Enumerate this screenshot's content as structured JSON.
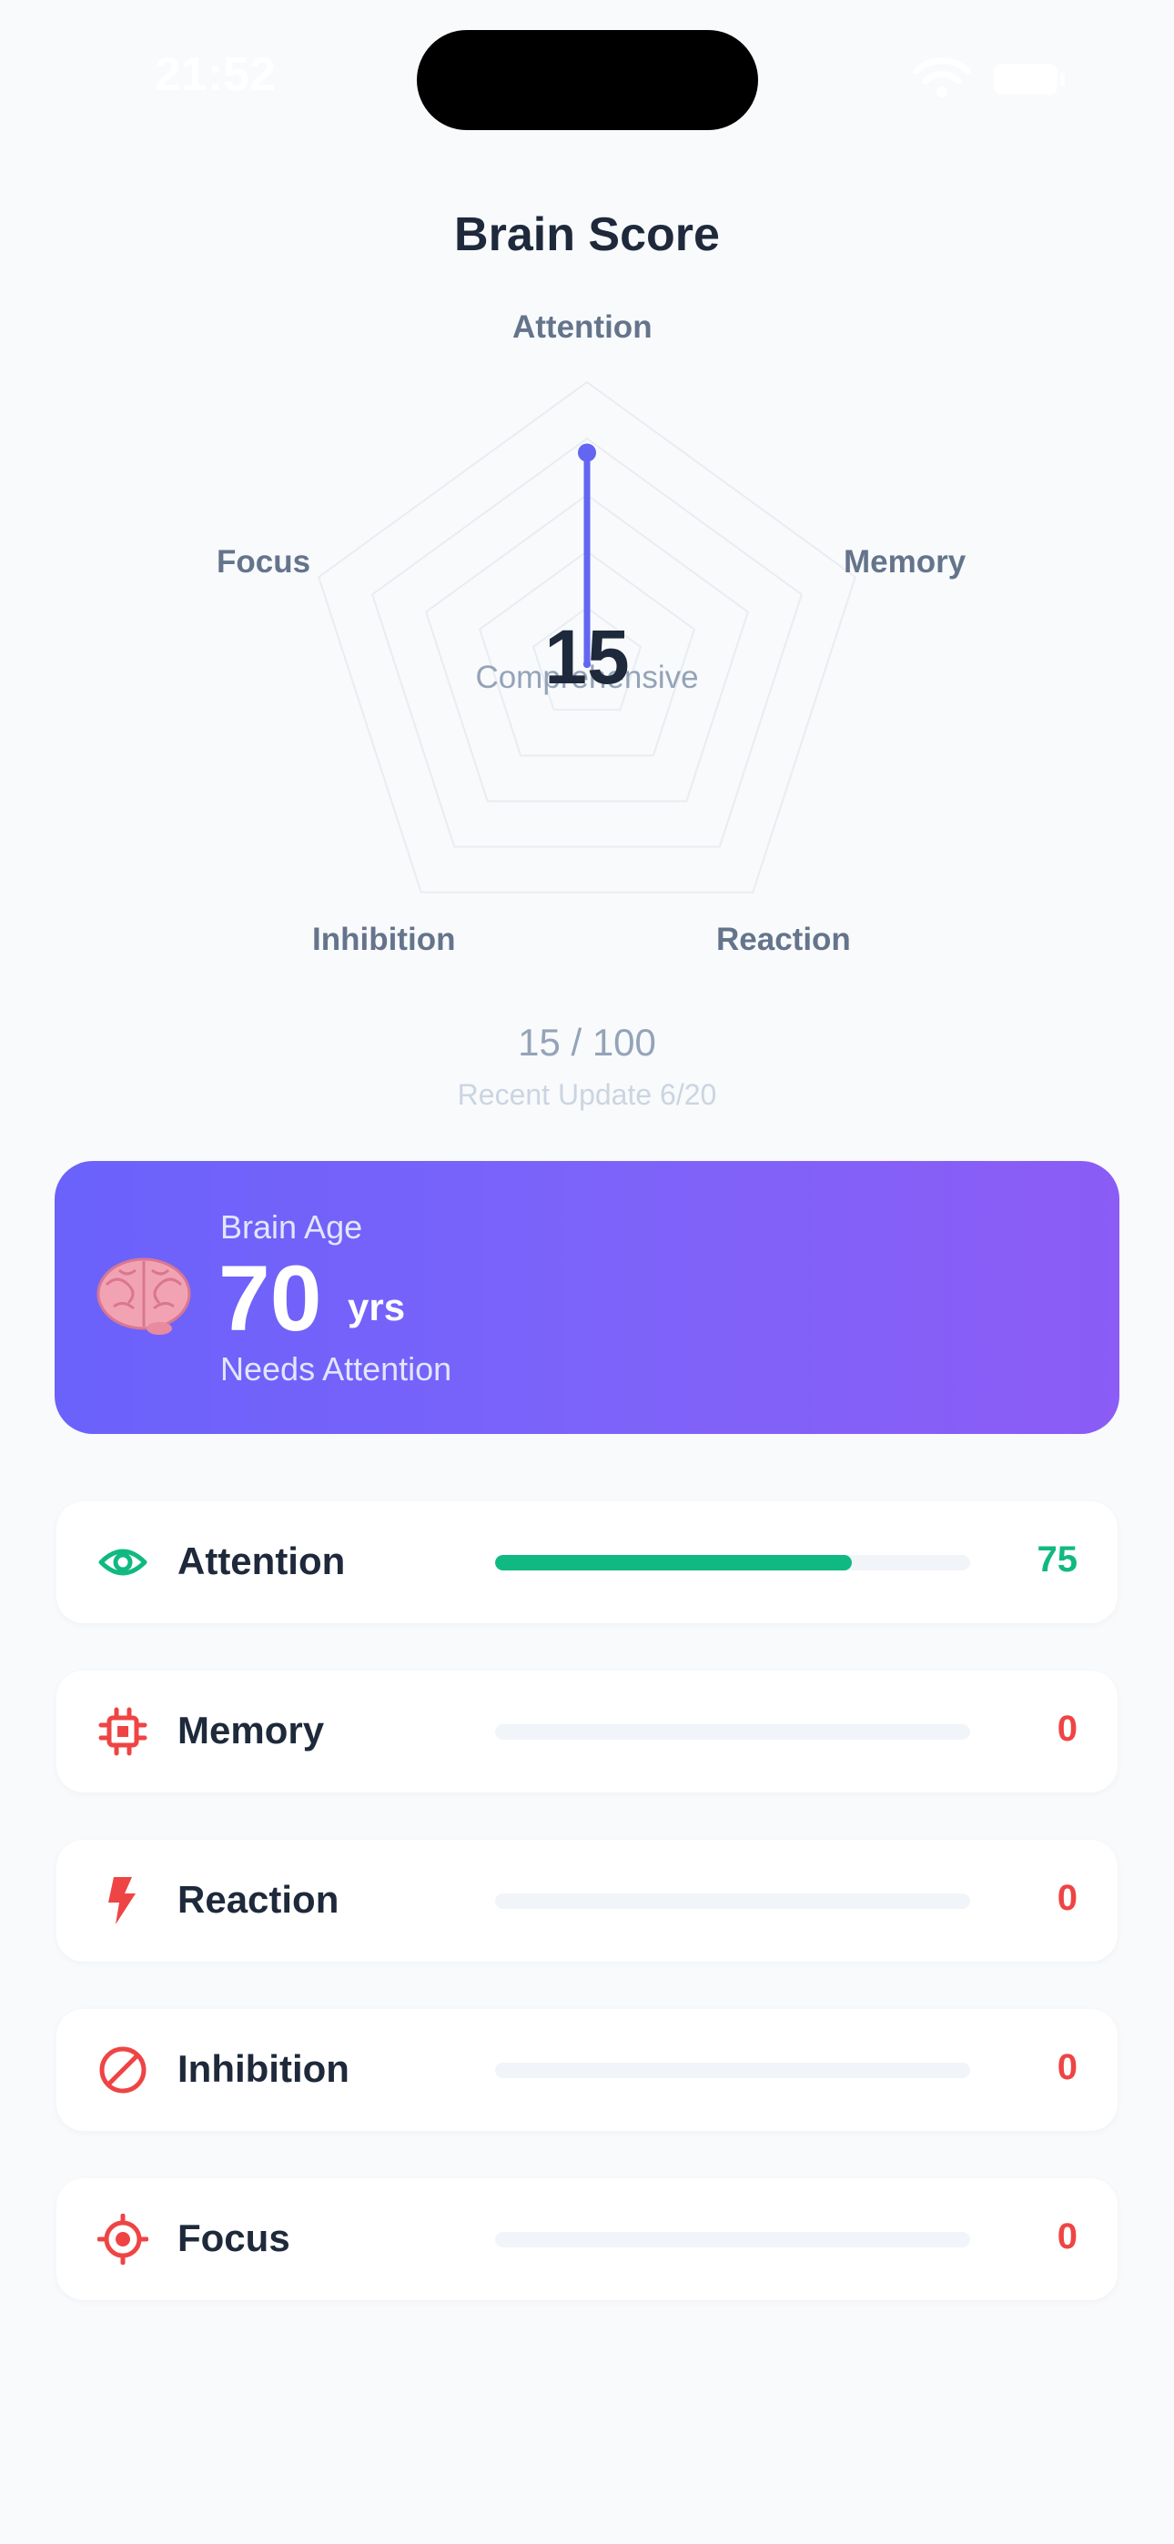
{
  "status_bar": {
    "time": "21:52"
  },
  "title": "Brain Score",
  "radar": {
    "axes": [
      "Attention",
      "Memory",
      "Reaction",
      "Inhibition",
      "Focus"
    ],
    "values": [
      75,
      0,
      0,
      0,
      0
    ],
    "max": 100,
    "center_score": "15",
    "center_caption": "Comprehensive",
    "accent_color": "#6366f1"
  },
  "score_total": "15 / 100",
  "recent_update": "Recent Update 6/20",
  "brain_age": {
    "label": "Brain Age",
    "value": "70",
    "unit": "yrs",
    "status": "Needs Attention",
    "icon": "brain-icon"
  },
  "metrics": [
    {
      "label": "Attention",
      "value": "75",
      "percent": 75,
      "icon": "eye-icon",
      "color": "#10b981"
    },
    {
      "label": "Memory",
      "value": "0",
      "percent": 0,
      "icon": "chip-icon",
      "color": "#ef4444"
    },
    {
      "label": "Reaction",
      "value": "0",
      "percent": 0,
      "icon": "bolt-icon",
      "color": "#ef4444"
    },
    {
      "label": "Inhibition",
      "value": "0",
      "percent": 0,
      "icon": "ban-icon",
      "color": "#ef4444"
    },
    {
      "label": "Focus",
      "value": "0",
      "percent": 0,
      "icon": "target-icon",
      "color": "#ef4444"
    }
  ]
}
